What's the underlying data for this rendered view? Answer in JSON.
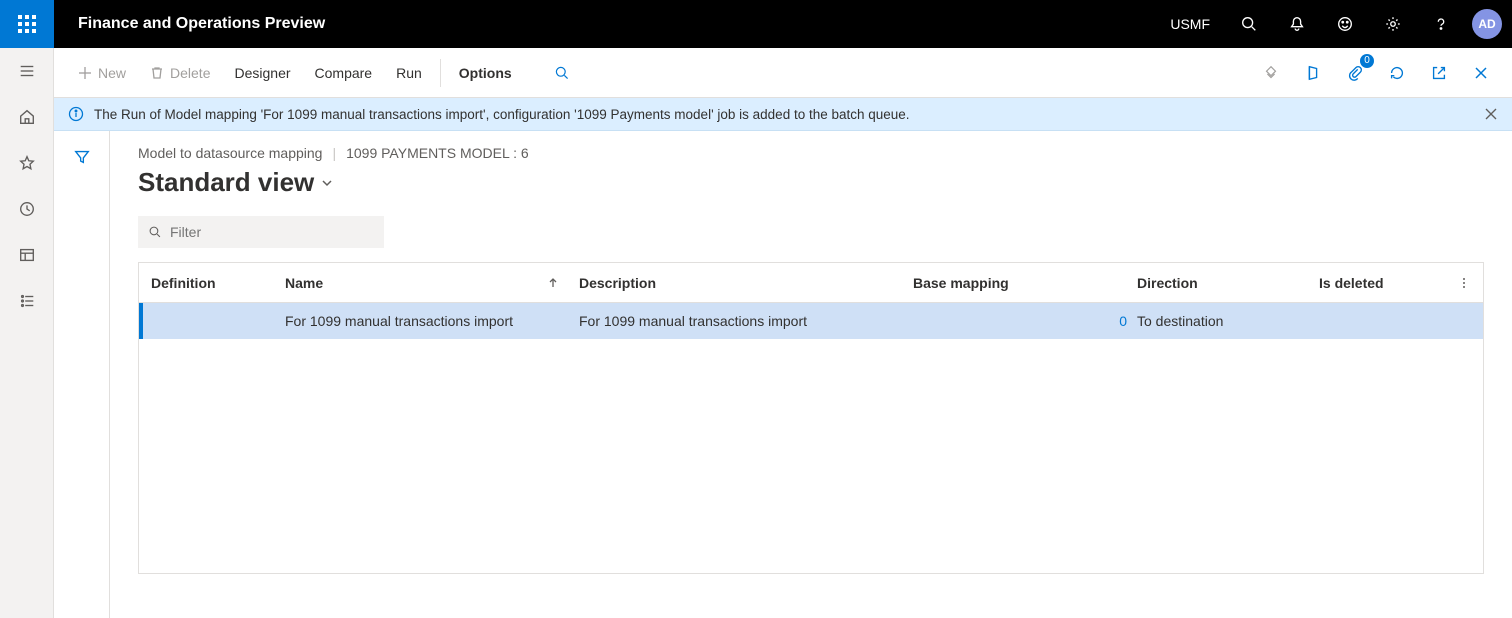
{
  "header": {
    "app_title": "Finance and Operations Preview",
    "entity": "USMF",
    "avatar_initials": "AD"
  },
  "action_pane": {
    "new_label": "New",
    "delete_label": "Delete",
    "designer_label": "Designer",
    "compare_label": "Compare",
    "run_label": "Run",
    "options_label": "Options",
    "attachments_badge": "0"
  },
  "info_bar": {
    "message": "The Run of Model mapping 'For 1099 manual transactions import', configuration '1099 Payments model' job is added to the batch queue."
  },
  "breadcrumb": {
    "part1": "Model to datasource mapping",
    "part2": "1099 PAYMENTS MODEL : 6"
  },
  "view_title": "Standard view",
  "filter_placeholder": "Filter",
  "grid": {
    "headers": {
      "definition": "Definition",
      "name": "Name",
      "description": "Description",
      "base_mapping": "Base mapping",
      "direction": "Direction",
      "is_deleted": "Is deleted"
    },
    "row": {
      "definition": "",
      "name": "For 1099 manual transactions import",
      "description": "For 1099 manual transactions import",
      "base_mapping": "",
      "base_mapping_num": "0",
      "direction": "To destination",
      "is_deleted": ""
    }
  }
}
